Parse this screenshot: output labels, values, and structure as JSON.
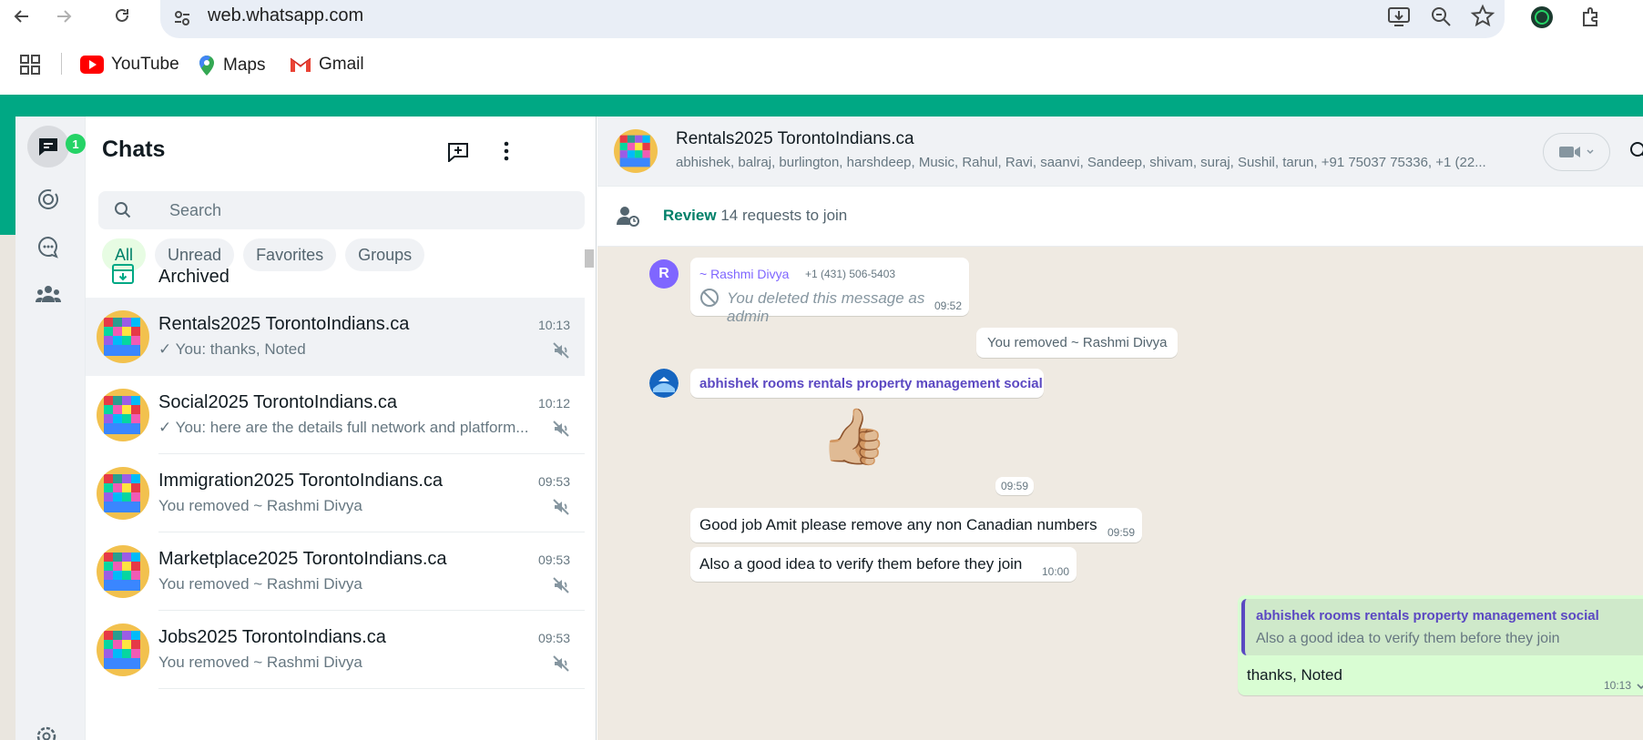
{
  "browser": {
    "url": "web.whatsapp.com",
    "bookmarks": [
      "YouTube",
      "Maps",
      "Gmail"
    ]
  },
  "rail": {
    "chats_badge": "1"
  },
  "chatlist": {
    "title": "Chats",
    "search_placeholder": "Search",
    "filters": [
      "All",
      "Unread",
      "Favorites",
      "Groups"
    ],
    "archived_label": "Archived",
    "chats": [
      {
        "name": "Rentals2025 TorontoIndians.ca",
        "time": "10:13",
        "preview": "✓ You: thanks, Noted",
        "muted": true,
        "selected": true
      },
      {
        "name": "Social2025 TorontoIndians.ca",
        "time": "10:12",
        "preview": "✓ You: here are the details full network and platform...",
        "muted": true,
        "selected": false
      },
      {
        "name": "Immigration2025 TorontoIndians.ca",
        "time": "09:53",
        "preview": "You removed ~ Rashmi Divya",
        "muted": true,
        "selected": false
      },
      {
        "name": "Marketplace2025 TorontoIndians.ca",
        "time": "09:53",
        "preview": "You removed ~ Rashmi Divya",
        "muted": true,
        "selected": false
      },
      {
        "name": "Jobs2025 TorontoIndians.ca",
        "time": "09:53",
        "preview": "You removed ~ Rashmi Divya",
        "muted": true,
        "selected": false
      }
    ]
  },
  "conversation": {
    "group_name": "Rentals2025 TorontoIndians.ca",
    "members": "abhishek, balraj, burlington, harshdeep, Music, Rahul, Ravi, saanvi, Sandeep, shivam, suraj, Sushil, tarun, +91 75037 75336, +1 (22...",
    "review": {
      "action": "Review",
      "text": "14 requests to join"
    },
    "messages": {
      "deleted": {
        "avatar_letter": "R",
        "sender": "~ Rashmi Divya",
        "phone": "+1 (431) 506-5403",
        "text": "You deleted this message as admin",
        "time": "09:52"
      },
      "system": "You removed ~ Rashmi Divya",
      "abhishek_sender": "abhishek rooms rentals property management social",
      "sticker_emoji": "👍🏼",
      "sticker_time": "09:59",
      "msg1": {
        "text": "Good job Amit please remove any non Canadian numbers",
        "time": "09:59"
      },
      "msg2": {
        "text": "Also a good idea to verify them before they join",
        "time": "10:00"
      },
      "reply": {
        "quoted_sender": "abhishek rooms rentals property management social",
        "quoted_text": "Also a good idea to verify them before they join",
        "text": "thanks, Noted",
        "time": "10:13"
      }
    }
  },
  "colors": {
    "brand_green": "#00a884",
    "outgoing_bubble": "#d9fdd3",
    "chat_bg": "#efeae2",
    "accent_text": "#008069",
    "sender_purple": "#7f66ff",
    "quote_sender": "#5b48c2"
  }
}
